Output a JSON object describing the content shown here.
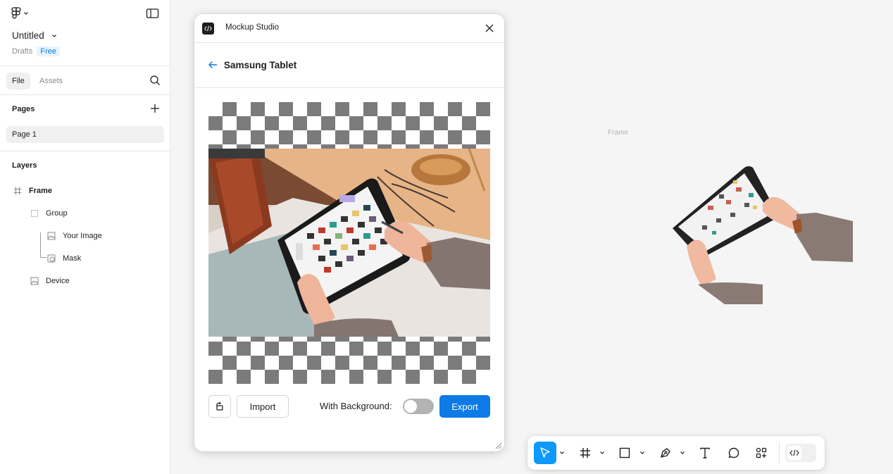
{
  "file": {
    "name": "Untitled",
    "location": "Drafts",
    "plan_badge": "Free"
  },
  "sidebar": {
    "tabs": [
      {
        "label": "File",
        "active": true
      },
      {
        "label": "Assets",
        "active": false
      }
    ],
    "pages_title": "Pages",
    "pages": [
      {
        "label": "Page 1",
        "selected": true
      }
    ],
    "layers_title": "Layers",
    "layers": [
      {
        "label": "Frame",
        "icon": "frame-icon"
      },
      {
        "label": "Group",
        "icon": "group-icon"
      },
      {
        "label": "Your Image",
        "icon": "image-icon"
      },
      {
        "label": "Mask",
        "icon": "mask-icon"
      },
      {
        "label": "Device",
        "icon": "image-icon"
      }
    ]
  },
  "canvas": {
    "frame_label": "Frame"
  },
  "plugin": {
    "title": "Mockup Studio",
    "device_name": "Samsung Tablet",
    "import_label": "Import",
    "background_label": "With Background:",
    "background_enabled": false,
    "export_label": "Export"
  },
  "toolbar": {
    "tools": [
      "move-tool",
      "frame-tool",
      "shape-tool",
      "pen-tool",
      "text-tool",
      "comment-tool",
      "actions-tool"
    ],
    "active_tool": "move-tool"
  },
  "colors": {
    "accent": "#0d99ff",
    "primary_button": "#0d7ae6",
    "free_badge_bg": "#e5f4ff"
  }
}
